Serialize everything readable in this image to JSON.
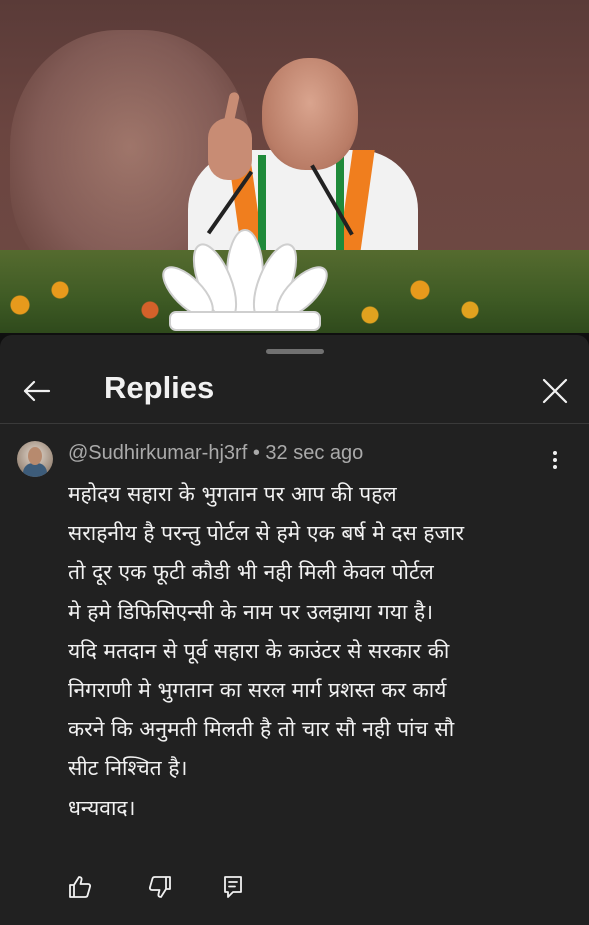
{
  "panel": {
    "title": "Replies"
  },
  "comment": {
    "author": "@Sudhirkumar-hj3rf",
    "separator": "•",
    "time": "32 sec ago",
    "lines": [
      "महोदय सहारा के भुगतान पर आप की पहल",
      "सराहनीय है परन्तु पोर्टल से हमे एक बर्ष मे दस हजार",
      "तो दूर एक फूटी कौडी भी नही मिली केवल पोर्टल",
      "मे हमे डिफिसिएन्सी के नाम पर उलझाया  गया है।",
      "यदि मतदान से पूर्व  सहारा के काउंटर से सरकार की",
      "निगराणी मे भुगतान का सरल मार्ग प्रशस्त कर कार्य",
      "करने कि अनुमती मिलती है तो चार सौ नही पांच सौ",
      "सीट निश्चित है।",
      "धन्यवाद।"
    ]
  },
  "icons": {
    "back": "back-arrow-icon",
    "close": "close-icon",
    "more": "more-vert-icon",
    "like": "thumb-up-icon",
    "dislike": "thumb-down-icon",
    "reply": "reply-comment-icon"
  },
  "colors": {
    "sheet_bg": "#212121",
    "text_primary": "#f1f1f1",
    "text_secondary": "#aaaaaa"
  }
}
